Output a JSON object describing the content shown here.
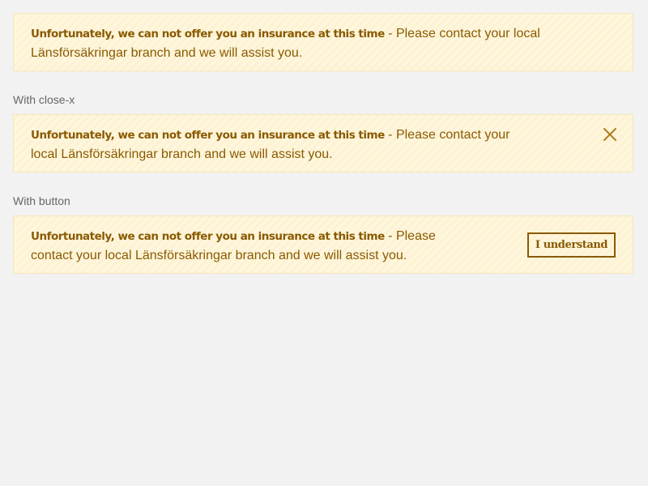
{
  "alerts": [
    {
      "title": "Unfortunately, we can not offer you an insurance at this time",
      "message": " - Please contact your local Länsförsäkringar branch and we will assist you."
    },
    {
      "section_label": "With close-x",
      "title": "Unfortunately, we can not offer you an insurance at this time",
      "message": " - Please contact your local Länsförsäkringar branch and we will assist you.",
      "close_icon": "close-icon"
    },
    {
      "section_label": "With button",
      "title": "Unfortunately, we can not offer you an insurance at this time",
      "message": " - Please contact your local Länsförsäkringar branch and we will assist you.",
      "button_label": "I understand"
    }
  ],
  "colors": {
    "page_background": "#f2f2f2",
    "alert_background": "#fdf3d3",
    "alert_border": "#f6e6b8",
    "alert_text": "#8a5a00",
    "section_label_text": "#666666"
  }
}
